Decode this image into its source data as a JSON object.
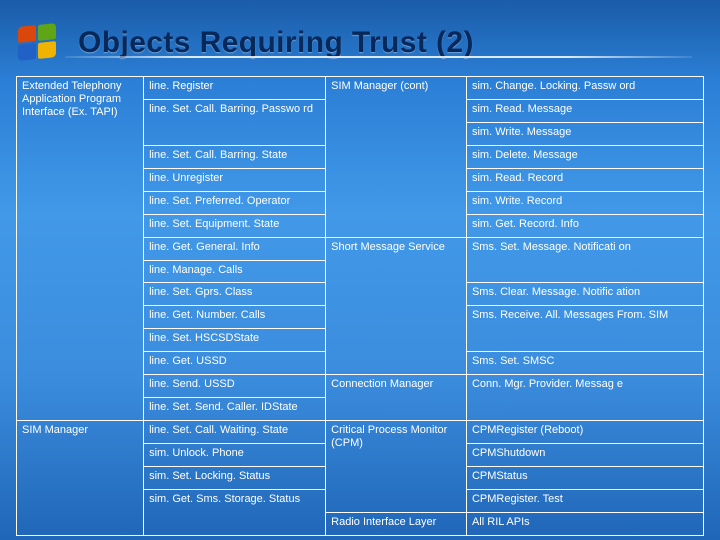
{
  "slide": {
    "title": "Objects Requiring Trust (2)"
  },
  "cells": {
    "r0c0": "Extended Telephony Application Program Interface (Ex. TAPI)",
    "r0c1": "line. Register",
    "r0c2": "SIM Manager (cont)",
    "r0c3": "sim. Change. Locking. Passw ord",
    "r1c1": "line. Set. Call. Barring. Passwo rd",
    "r1c3": "sim. Read. Message",
    "r2c1": "line. Set. Call. Barring. State",
    "r2c3": "sim. Write. Message",
    "r3c1": "line. Unregister",
    "r3c3": "sim. Delete. Message",
    "r4c1": "line. Set. Preferred. Operator",
    "r4c3": "sim. Read. Record",
    "r5c1": "line. Set. Equipment. State",
    "r5c3": "sim. Write. Record",
    "r6c1": "line. Get. General. Info",
    "r6c3": "sim. Get. Record. Info",
    "r7c1": "line. Manage. Calls",
    "r7c2": "Short Message Service",
    "r7c3": "Sms. Set. Message. Notificati on",
    "r8c1": "line. Set. Gprs. Class",
    "r9c1": "line. Get. Number. Calls",
    "r9c3": "Sms. Clear. Message. Notific ation",
    "r10c1": "line. Set. HSCSDState",
    "r10c3": "Sms. Receive. All. Messages From. SIM",
    "r11c1": "line. Get. USSD",
    "r12c1": "line. Send. USSD",
    "r12c3": "Sms. Set. SMSC",
    "r13c1": "line. Set. Send. Caller. IDState",
    "r13c2": "Connection Manager",
    "r13c3": "Conn. Mgr. Provider. Messag e",
    "r14c1": "line. Set. Call. Waiting. State",
    "r15c0": "SIM Manager",
    "r15c1": "sim. Unlock. Phone",
    "r15c2": "Critical Process Monitor (CPM)",
    "r15c3": "CPMRegister (Reboot)",
    "r16c1": "sim. Set. Locking. Status",
    "r16c3": "CPMShutdown",
    "r17c1": "sim. Get. Sms. Storage. Status",
    "r17c3": "CPMStatus",
    "r18c3": "CPMRegister. Test",
    "r19c2": "Radio Interface Layer",
    "r19c3": "All RIL APIs"
  }
}
